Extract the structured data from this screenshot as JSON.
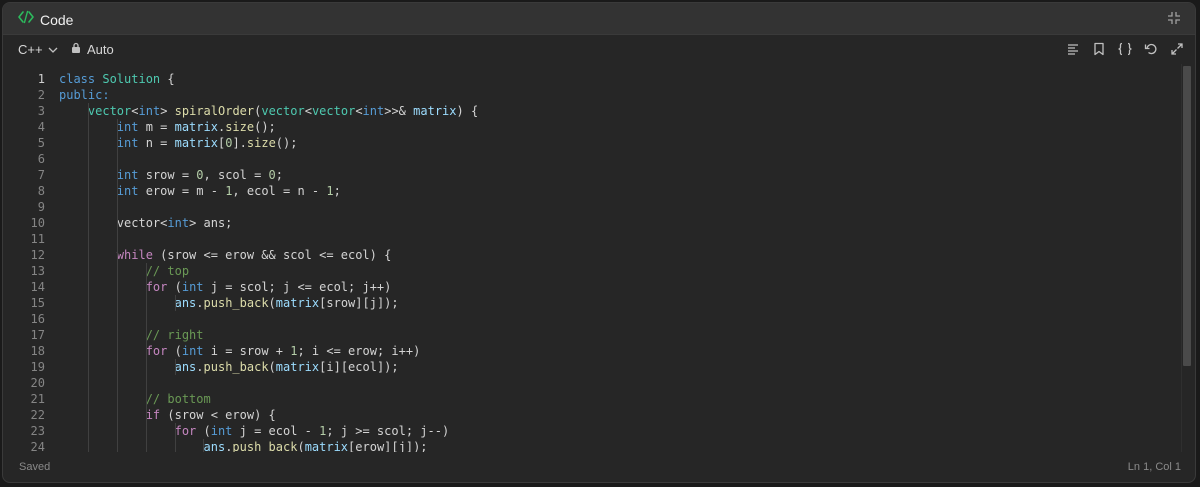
{
  "header": {
    "title": "Code"
  },
  "toolbar": {
    "language": "C++",
    "mode": "Auto"
  },
  "status": {
    "saved": "Saved",
    "position": "Ln 1, Col 1"
  },
  "editor": {
    "lines": [
      {
        "n": "1"
      },
      {
        "n": "2"
      },
      {
        "n": "3"
      },
      {
        "n": "4"
      },
      {
        "n": "5"
      },
      {
        "n": "6"
      },
      {
        "n": "7"
      },
      {
        "n": "8"
      },
      {
        "n": "9"
      },
      {
        "n": "10"
      },
      {
        "n": "11"
      },
      {
        "n": "12"
      },
      {
        "n": "13"
      },
      {
        "n": "14"
      },
      {
        "n": "15"
      },
      {
        "n": "16"
      },
      {
        "n": "17"
      },
      {
        "n": "18"
      },
      {
        "n": "19"
      },
      {
        "n": "20"
      },
      {
        "n": "21"
      },
      {
        "n": "22"
      },
      {
        "n": "23"
      },
      {
        "n": "24"
      }
    ],
    "code": [
      [
        [
          "cls2",
          "class "
        ],
        [
          "cls",
          "Solution "
        ],
        [
          "op",
          "{"
        ]
      ],
      [
        [
          "pub",
          "public:"
        ]
      ],
      [
        [
          "op",
          "    "
        ],
        [
          "cls",
          "vector"
        ],
        [
          "op",
          "<"
        ],
        [
          "tp",
          "int"
        ],
        [
          "op",
          "> "
        ],
        [
          "fn",
          "spiralOrder"
        ],
        [
          "op",
          "("
        ],
        [
          "cls",
          "vector"
        ],
        [
          "op",
          "<"
        ],
        [
          "cls",
          "vector"
        ],
        [
          "op",
          "<"
        ],
        [
          "tp",
          "int"
        ],
        [
          "op",
          ">>& "
        ],
        [
          "var",
          "matrix"
        ],
        [
          "op",
          ") {"
        ]
      ],
      [
        [
          "op",
          "        "
        ],
        [
          "tp",
          "int"
        ],
        [
          "op",
          " m = "
        ],
        [
          "var",
          "matrix"
        ],
        [
          "op",
          "."
        ],
        [
          "fn",
          "size"
        ],
        [
          "op",
          "();"
        ]
      ],
      [
        [
          "op",
          "        "
        ],
        [
          "tp",
          "int"
        ],
        [
          "op",
          " n = "
        ],
        [
          "var",
          "matrix"
        ],
        [
          "op",
          "["
        ],
        [
          "num",
          "0"
        ],
        [
          "op",
          "]."
        ],
        [
          "fn",
          "size"
        ],
        [
          "op",
          "();"
        ]
      ],
      [
        [
          "op",
          ""
        ]
      ],
      [
        [
          "op",
          "        "
        ],
        [
          "tp",
          "int"
        ],
        [
          "op",
          " srow = "
        ],
        [
          "num",
          "0"
        ],
        [
          "op",
          ", scol = "
        ],
        [
          "num",
          "0"
        ],
        [
          "op",
          ";"
        ]
      ],
      [
        [
          "op",
          "        "
        ],
        [
          "tp",
          "int"
        ],
        [
          "op",
          " erow = m - "
        ],
        [
          "num",
          "1"
        ],
        [
          "op",
          ", ecol = n - "
        ],
        [
          "num",
          "1"
        ],
        [
          "op",
          ";"
        ]
      ],
      [
        [
          "op",
          ""
        ]
      ],
      [
        [
          "op",
          "        vector<"
        ],
        [
          "tp",
          "int"
        ],
        [
          "op",
          "> ans;"
        ]
      ],
      [
        [
          "op",
          ""
        ]
      ],
      [
        [
          "op",
          "        "
        ],
        [
          "kw",
          "while"
        ],
        [
          "op",
          " (srow <= erow && scol <= ecol) {"
        ]
      ],
      [
        [
          "op",
          "            "
        ],
        [
          "cm",
          "// top"
        ]
      ],
      [
        [
          "op",
          "            "
        ],
        [
          "kw",
          "for"
        ],
        [
          "op",
          " ("
        ],
        [
          "tp",
          "int"
        ],
        [
          "op",
          " j = scol; j <= ecol; j++)"
        ]
      ],
      [
        [
          "op",
          "                "
        ],
        [
          "var",
          "ans"
        ],
        [
          "op",
          "."
        ],
        [
          "fn",
          "push_back"
        ],
        [
          "op",
          "("
        ],
        [
          "var",
          "matrix"
        ],
        [
          "op",
          "[srow][j]);"
        ]
      ],
      [
        [
          "op",
          ""
        ]
      ],
      [
        [
          "op",
          "            "
        ],
        [
          "cm",
          "// right"
        ]
      ],
      [
        [
          "op",
          "            "
        ],
        [
          "kw",
          "for"
        ],
        [
          "op",
          " ("
        ],
        [
          "tp",
          "int"
        ],
        [
          "op",
          " i = srow + "
        ],
        [
          "num",
          "1"
        ],
        [
          "op",
          "; i <= erow; i++)"
        ]
      ],
      [
        [
          "op",
          "                "
        ],
        [
          "var",
          "ans"
        ],
        [
          "op",
          "."
        ],
        [
          "fn",
          "push_back"
        ],
        [
          "op",
          "("
        ],
        [
          "var",
          "matrix"
        ],
        [
          "op",
          "[i][ecol]);"
        ]
      ],
      [
        [
          "op",
          ""
        ]
      ],
      [
        [
          "op",
          "            "
        ],
        [
          "cm",
          "// bottom"
        ]
      ],
      [
        [
          "op",
          "            "
        ],
        [
          "kw",
          "if"
        ],
        [
          "op",
          " (srow < erow) {"
        ]
      ],
      [
        [
          "op",
          "                "
        ],
        [
          "kw",
          "for"
        ],
        [
          "op",
          " ("
        ],
        [
          "tp",
          "int"
        ],
        [
          "op",
          " j = ecol - "
        ],
        [
          "num",
          "1"
        ],
        [
          "op",
          "; j >= scol; j--)"
        ]
      ],
      [
        [
          "op",
          "                    "
        ],
        [
          "var",
          "ans"
        ],
        [
          "op",
          "."
        ],
        [
          "fn",
          "push_back"
        ],
        [
          "op",
          "("
        ],
        [
          "var",
          "matrix"
        ],
        [
          "op",
          "[erow][j]);"
        ]
      ]
    ]
  },
  "icons": {
    "code": "code-brackets-icon",
    "collapse": "collapse-icon",
    "chevron": "chevron-down-icon",
    "lock": "lock-icon",
    "format": "format-lines-icon",
    "bookmark": "bookmark-icon",
    "braces": "braces-icon",
    "reset": "reset-icon",
    "expand": "expand-icon"
  },
  "colors": {
    "accent": "#2cbb5d",
    "keyword": "#c586c0",
    "type": "#569cd6",
    "class": "#4ec9b0",
    "function": "#dcdcaa",
    "variable": "#9cdcfe",
    "number": "#b5cea8",
    "comment": "#6a9955"
  }
}
